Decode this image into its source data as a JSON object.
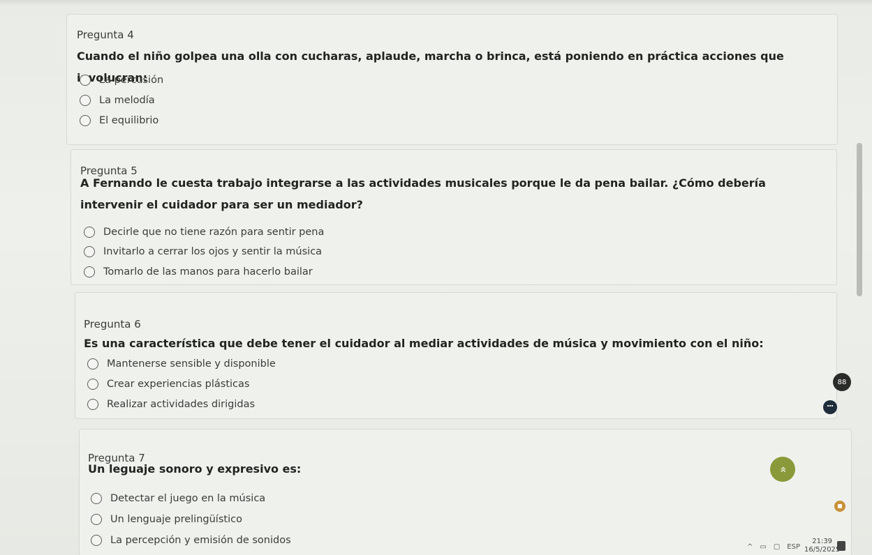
{
  "questions": [
    {
      "number": "Pregunta 4",
      "text": "Cuando el niño golpea una olla con cucharas, aplaude, marcha o brinca, está poniendo en práctica acciones que involucran:",
      "options": [
        "La percusión",
        "La melodía",
        "El equilibrio"
      ]
    },
    {
      "number": "Pregunta 5",
      "text": "A Fernando le cuesta trabajo integrarse a las actividades musicales porque le da pena bailar. ¿Cómo debería intervenir el cuidador para ser un mediador?",
      "options": [
        "Decirle que no tiene razón para sentir pena",
        "Invitarlo a cerrar los ojos y sentir la música",
        "Tomarlo de las manos para hacerlo bailar"
      ]
    },
    {
      "number": "Pregunta 6",
      "text": "Es una característica que debe tener el cuidador al mediar actividades de música y movimiento con el niño:",
      "options": [
        "Mantenerse sensible y disponible",
        "Crear experiencias plásticas",
        "Realizar actividades dirigidas"
      ]
    },
    {
      "number": "Pregunta 7",
      "text": "Un leguaje sonoro y expresivo es:",
      "options": [
        "Detectar el juego en la música",
        "Un lenguaje prelingüístico",
        "La percepción y emisión de sonidos"
      ]
    }
  ],
  "floating": {
    "scroll_top_glyph": "»",
    "grid_glyph": "88"
  },
  "taskbar": {
    "language": "ESP",
    "time": "21:39",
    "date": "16/5/2025"
  },
  "colors": {
    "scroll_top_button": "#8a9a3a",
    "grid_button": "#2a2c2a",
    "assistant_button": "#1f2c3a"
  }
}
